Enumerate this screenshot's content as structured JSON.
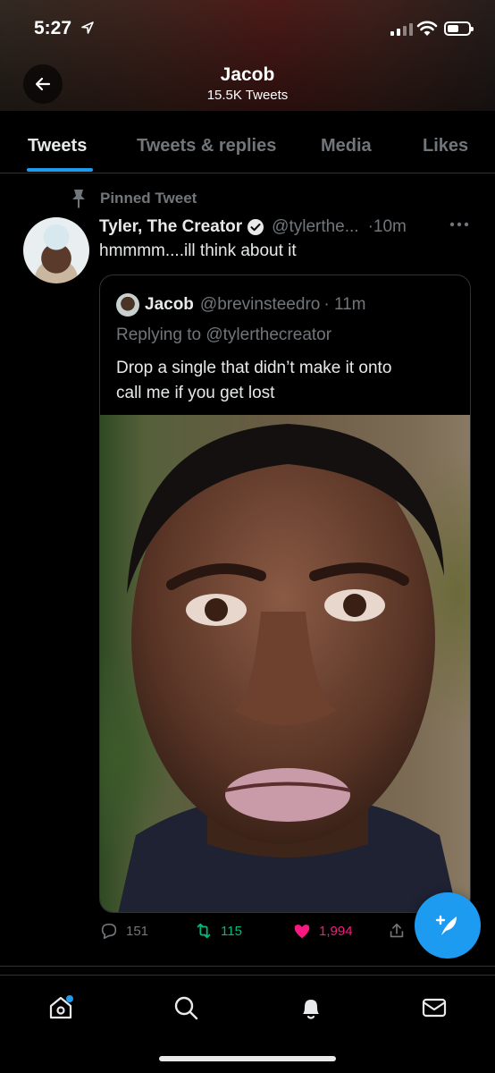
{
  "status_bar": {
    "time": "5:27"
  },
  "header": {
    "name": "Jacob",
    "tweet_count": "15.5K Tweets"
  },
  "tabs": [
    {
      "label": "Tweets",
      "active": true
    },
    {
      "label": "Tweets & replies",
      "active": false
    },
    {
      "label": "Media",
      "active": false
    },
    {
      "label": "Likes",
      "active": false
    }
  ],
  "tweet": {
    "pinned_label": "Pinned Tweet",
    "author_name": "Tyler, The Creator",
    "author_handle": "@tylerthe...",
    "time": "·10m",
    "text": "hmmmm....ill think about it",
    "quote": {
      "author_name": "Jacob",
      "author_handle": "@brevinsteedro",
      "time": "· 11m",
      "replying_to": "Replying to @tylerthecreator",
      "text_line1": "Drop a single that didn’t make it onto",
      "text_line2": "call me if you get lost"
    },
    "actions": {
      "replies": "151",
      "retweets": "115",
      "likes": "1,994"
    }
  },
  "colors": {
    "accent": "#1d9bf0",
    "retweet": "#00ba7c",
    "like": "#f91880",
    "muted": "#71767b"
  },
  "icons": [
    "back-arrow-icon",
    "pin-icon",
    "verified-badge-icon",
    "more-icon",
    "reply-icon",
    "retweet-icon",
    "heart-icon",
    "share-icon",
    "compose-icon",
    "home-icon",
    "search-icon",
    "notifications-icon",
    "messages-icon"
  ]
}
